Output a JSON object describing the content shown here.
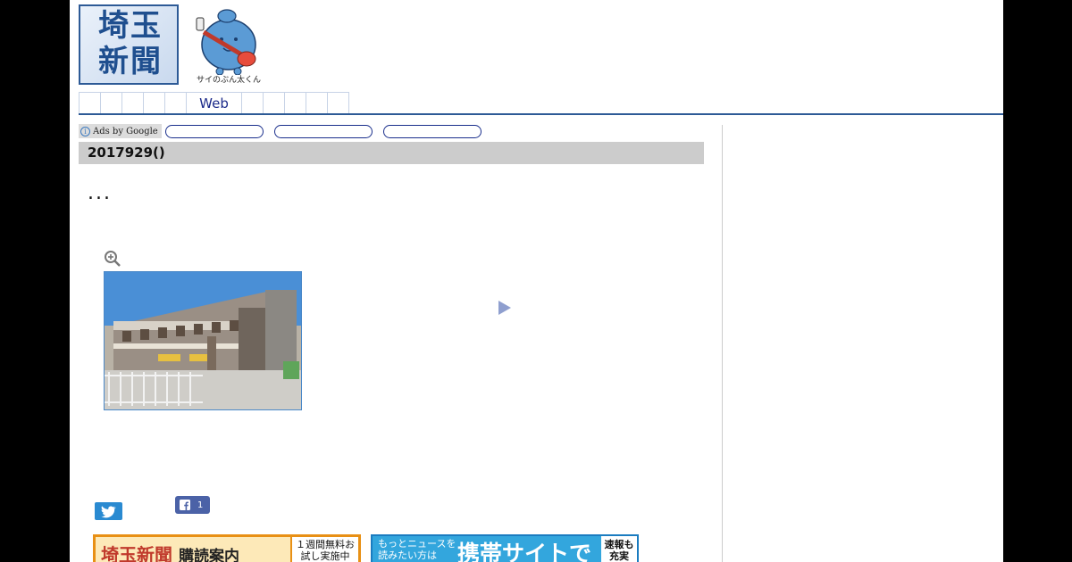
{
  "header": {
    "logo_text": "埼玉新聞",
    "mascot_caption": "サイのぶん太くん"
  },
  "nav": {
    "tabs": [
      "",
      "",
      "",
      "",
      "",
      "Web",
      "",
      "",
      "",
      "",
      ""
    ]
  },
  "ads": {
    "label": "Ads by Google"
  },
  "article": {
    "date": "2017929()",
    "headline": "..."
  },
  "share": {
    "facebook_count": "1"
  },
  "banners": {
    "subscribe_title": "埼玉新聞",
    "subscribe_sub": "購読案内",
    "subscribe_trial": "１週間無料お試し実施中",
    "mobile_lead": "もっとニュースを読みたい方は",
    "mobile_main": "携帯サイトで",
    "mobile_side": "速報も充実"
  },
  "colors": {
    "brand_blue": "#2d5a96",
    "nav_text": "#1c2b8a",
    "date_bar": "#cccccc",
    "twitter": "#2a8ad1",
    "facebook": "#4b62a7"
  }
}
